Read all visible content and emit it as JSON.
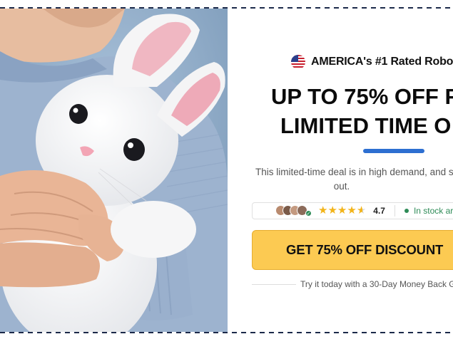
{
  "badge": {
    "text": "AMERICA's #1 Rated Robo",
    "icon": "us-flag-icon"
  },
  "headline": {
    "line1": "UP TO 75% OFF F",
    "line2": "LIMITED TIME O"
  },
  "description": {
    "line1": "This limited-time deal is in high demand, and s",
    "line2": "out."
  },
  "social_proof": {
    "avatar_count": 4,
    "stars": 4.5,
    "rating": "4.7",
    "stock_text": "In stock ar"
  },
  "cta": {
    "label": "GET 75% OFF DISCOUNT"
  },
  "guarantee": {
    "text": "Try it today with a 30-Day Money Back Gu"
  },
  "colors": {
    "cta_background": "#fcca52",
    "accent_bar": "#2d6fd1",
    "stock_green": "#2e8b57",
    "star_gold": "#f2b41a",
    "border_dash": "#1c2a4a"
  },
  "image": {
    "subject": "bunny-plush-photo"
  }
}
